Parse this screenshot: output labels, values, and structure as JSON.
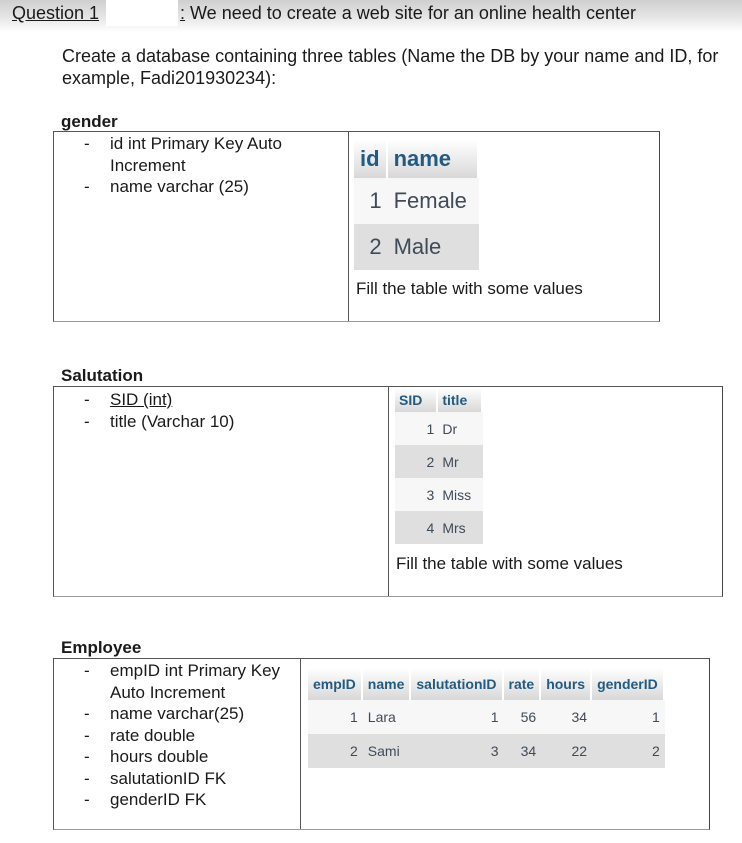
{
  "header": {
    "question_label": "Question 1",
    "colon": ":",
    "text": " We need to create a web site for an online health center"
  },
  "intro": "Create a database containing three tables (Name the DB by your name and ID, for example, Fadi201930234):",
  "gender": {
    "title": "gender",
    "fields": [
      "id int Primary Key Auto Increment",
      "name varchar (25)"
    ],
    "table": {
      "columns": [
        "id",
        "name"
      ],
      "rows": [
        [
          "1",
          "Female"
        ],
        [
          "2",
          "Male"
        ]
      ]
    },
    "note": "Fill the table with some values"
  },
  "salutation": {
    "title": "Salutation",
    "fields": [
      "SID (int)",
      "title (Varchar 10)"
    ],
    "table": {
      "columns": [
        "SID",
        "title"
      ],
      "rows": [
        [
          "1",
          "Dr"
        ],
        [
          "2",
          "Mr"
        ],
        [
          "3",
          "Miss"
        ],
        [
          "4",
          "Mrs"
        ]
      ]
    },
    "note": "Fill the table with some values"
  },
  "employee": {
    "title": "Employee",
    "fields": [
      "empID int Primary Key Auto Increment",
      "name varchar(25)",
      "rate double",
      "hours double",
      "salutationID FK",
      "genderID FK"
    ],
    "table": {
      "columns": [
        "empID",
        "name",
        "salutationID",
        "rate",
        "hours",
        "genderID"
      ],
      "rows": [
        [
          "1",
          "Lara",
          "1",
          "56",
          "34",
          "1"
        ],
        [
          "2",
          "Sami",
          "3",
          "34",
          "22",
          "2"
        ]
      ]
    }
  }
}
